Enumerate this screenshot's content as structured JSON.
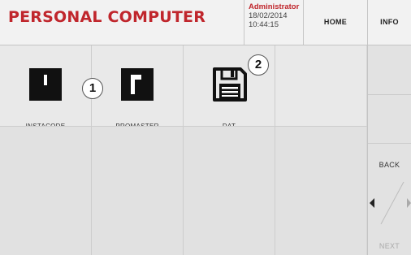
{
  "header": {
    "title": "PERSONAL COMPUTER",
    "user_name": "Administrator",
    "date": "18/02/2014",
    "time": "10:44:15",
    "home_label": "HOME",
    "info_label": "INFO"
  },
  "grid": {
    "items": [
      {
        "label": "INSTACODE",
        "icon": "instacode-icon"
      },
      {
        "label": "PROMASTER",
        "icon": "promaster-icon"
      },
      {
        "label": "DAT",
        "icon": "floppy-disk-icon"
      }
    ]
  },
  "callouts": [
    "1",
    "2"
  ],
  "nav": {
    "back_label": "BACK",
    "next_label": "NEXT"
  },
  "colors": {
    "accent": "#c0262c",
    "background": "#e9e9e9"
  }
}
